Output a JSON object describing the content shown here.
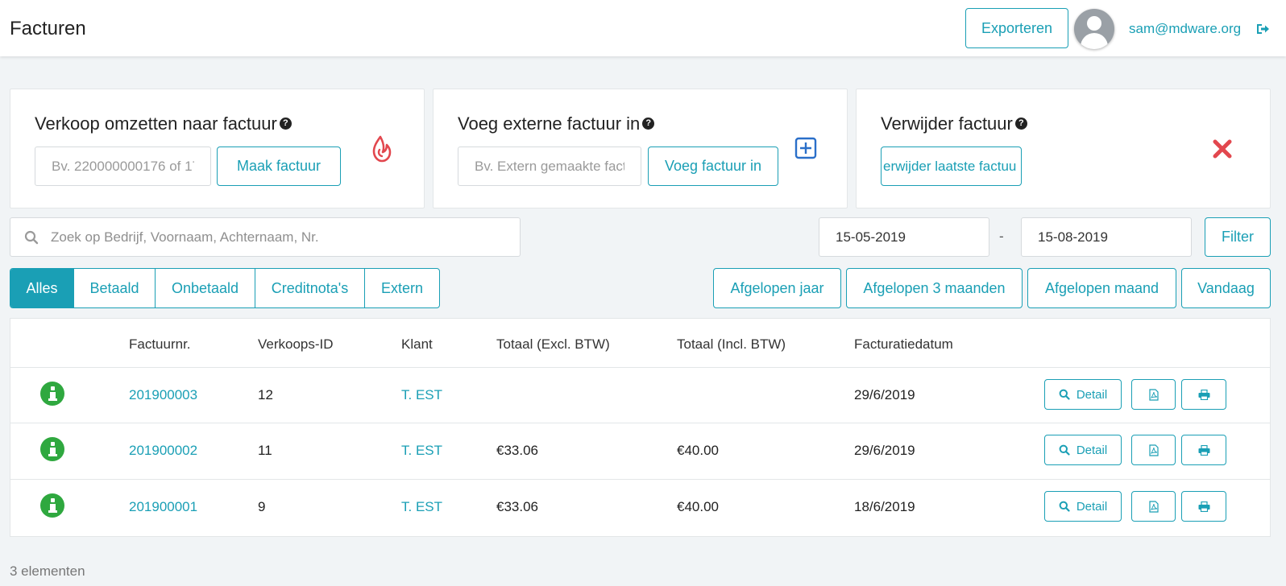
{
  "header": {
    "title": "Facturen",
    "export_label": "Exporteren",
    "user_email": "sam@mdware.org"
  },
  "cards": {
    "convert": {
      "title": "Verkoop omzetten naar factuur",
      "placeholder": "Bv. 220000000176 of 17",
      "button": "Maak factuur",
      "icon": "lightspeed-flame-icon"
    },
    "external": {
      "title": "Voeg externe factuur in",
      "placeholder": "Bv. Extern gemaakte fact",
      "button": "Voeg factuur in",
      "icon": "plus-square-icon"
    },
    "delete": {
      "title": "Verwijder factuur",
      "button": "erwijder laatste factuu",
      "icon": "red-x-icon"
    }
  },
  "search": {
    "placeholder": "Zoek op Bedrijf, Voornaam, Achternaam, Nr."
  },
  "date_filter": {
    "from": "15-05-2019",
    "separator": "-",
    "to": "15-08-2019",
    "filter_label": "Filter"
  },
  "tabs": [
    "Alles",
    "Betaald",
    "Onbetaald",
    "Creditnota's",
    "Extern"
  ],
  "active_tab": "Alles",
  "ranges": [
    "Afgelopen jaar",
    "Afgelopen 3 maanden",
    "Afgelopen maand",
    "Vandaag"
  ],
  "table": {
    "columns": [
      "Factuurnr.",
      "Verkoops-ID",
      "Klant",
      "Totaal (Excl. BTW)",
      "Totaal (Incl. BTW)",
      "Facturatiedatum"
    ],
    "detail_label": "Detail",
    "rows": [
      {
        "nr": "201900003",
        "sale_id": "12",
        "client": "T. EST",
        "excl": "",
        "incl": "",
        "date": "29/6/2019"
      },
      {
        "nr": "201900002",
        "sale_id": "11",
        "client": "T. EST",
        "excl": "€33.06",
        "incl": "€40.00",
        "date": "29/6/2019"
      },
      {
        "nr": "201900001",
        "sale_id": "9",
        "client": "T. EST",
        "excl": "€33.06",
        "incl": "€40.00",
        "date": "18/6/2019"
      }
    ]
  },
  "footer": {
    "count_text": "3 elementen"
  },
  "colors": {
    "accent": "#1a9fb5",
    "success": "#2fa83f",
    "danger": "#e2474e",
    "background": "#f1f4f6"
  }
}
